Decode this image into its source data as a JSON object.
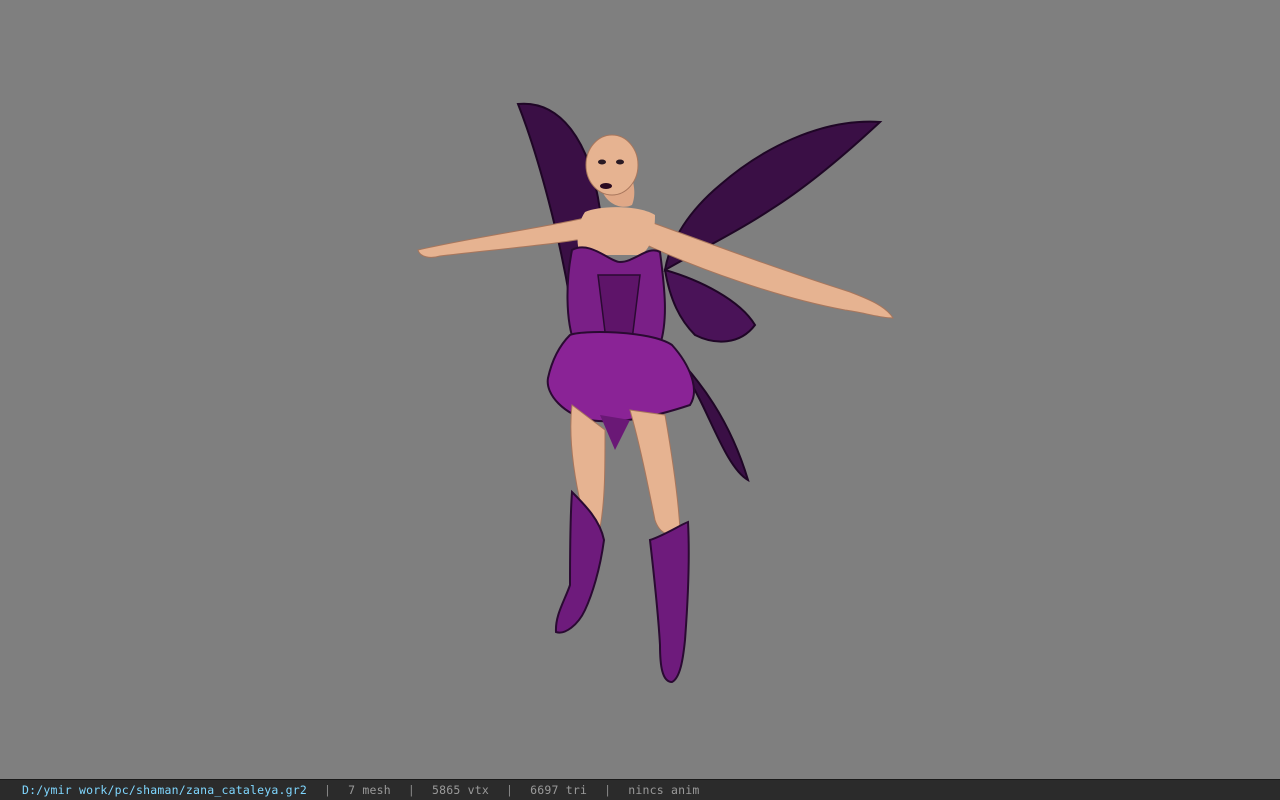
{
  "statusbar": {
    "file_path": "D:/ymir work/pc/shaman/zana_cataleya.gr2",
    "separator": "|",
    "mesh_count": "7 mesh",
    "vertex_count": "5865 vtx",
    "triangle_count": "6697 tri",
    "animation": "nincs anim"
  },
  "viewport": {
    "background_color": "#7f7f7f",
    "model_colors": {
      "outfit": "#7a1f87",
      "outfit_dark": "#2a0a32",
      "skin": "#e6b391",
      "wing": "#3a0f45"
    }
  }
}
